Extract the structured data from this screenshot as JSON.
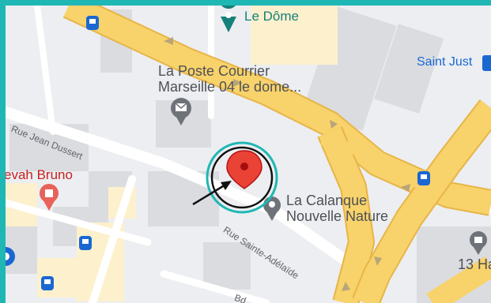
{
  "frame": {
    "border_color": "#1fb7b4"
  },
  "places": [
    {
      "id": "le-dome",
      "label": "Le Dôme",
      "icon": "music-venue-pin",
      "color": "#16807a"
    },
    {
      "id": "la-poste",
      "label_line1": "La Poste Courrier",
      "label_line2": "Marseille 04 le dome...",
      "icon": "mail-pin",
      "color": "#5f6368"
    },
    {
      "id": "saint-just",
      "label": "Saint Just",
      "icon": "metro-stop",
      "color": "#1a67d2"
    },
    {
      "id": "calanque",
      "label_line1": "La Calanque",
      "label_line2": "Nouvelle Nature",
      "icon": "place-pin",
      "color": "#5f6368"
    },
    {
      "id": "bruno",
      "label": "evah Bruno",
      "icon": "medical-pin",
      "color": "#c5221f"
    },
    {
      "id": "thirteen",
      "label": "13 Ha",
      "icon": "museum-pin",
      "color": "#5f6368"
    }
  ],
  "streets": [
    {
      "id": "jean-dussert",
      "label": "Rue Jean Dussert"
    },
    {
      "id": "sainte-adelaide",
      "label": "Rue Sainte-Adélaïde"
    },
    {
      "id": "bd",
      "label": "Bd"
    }
  ],
  "selected_pin": {
    "icon": "location-pin",
    "color": "#ea4335",
    "highlight_color": "#1fb7b4"
  },
  "colors": {
    "highway": "#f8d26a",
    "highway_edge": "#e7b548",
    "land": "#eceef1",
    "block": "#dadce0",
    "sand": "#fdf0cd",
    "bus": "#1a67d2"
  }
}
